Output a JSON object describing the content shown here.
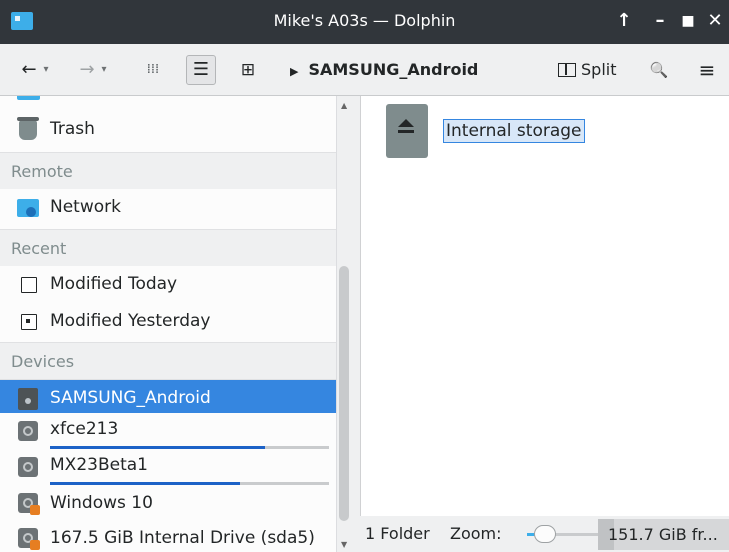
{
  "window": {
    "title": "Mike's A03s — Dolphin",
    "buttons": {
      "keep_above": "↑",
      "minimize": "–",
      "maximize": "■",
      "close": "✕"
    }
  },
  "toolbar": {
    "back": "←",
    "forward": "→",
    "dropdown": "▾",
    "icons_view": "⁞⁞⁞",
    "details_view": "☰",
    "compact_view": "⊞",
    "breadcrumb_arrow": "▶",
    "breadcrumb": "SAMSUNG_Android",
    "split_label": "Split",
    "search": "🔍",
    "menu": "≡"
  },
  "sidebar": {
    "places": [
      {
        "label": "Trash",
        "icon": "trash-icon"
      }
    ],
    "remote_header": "Remote",
    "remote": [
      {
        "label": "Network",
        "icon": "network-folder-icon"
      }
    ],
    "recent_header": "Recent",
    "recent": [
      {
        "label": "Modified Today",
        "icon": "calendar-icon"
      },
      {
        "label": "Modified Yesterday",
        "icon": "calendar-day-icon"
      }
    ],
    "devices_header": "Devices",
    "devices": [
      {
        "label": "SAMSUNG_Android",
        "icon": "phone-icon",
        "selected": true
      },
      {
        "label": "xfce213",
        "icon": "disk-icon",
        "usage": 0.77
      },
      {
        "label": "MX23Beta1",
        "icon": "disk-icon",
        "usage": 0.68
      },
      {
        "label": "Windows 10",
        "icon": "windows-disk-icon"
      },
      {
        "label": "167.5 GiB Internal Drive (sda5)",
        "icon": "windows-disk-icon"
      }
    ]
  },
  "main": {
    "items": [
      {
        "name": "Internal storage",
        "icon": "storage-icon",
        "selected": true
      }
    ]
  },
  "statusbar": {
    "summary": "1 Folder",
    "zoom_label": "Zoom:",
    "zoom_level": 0.1,
    "free_space": "151.7 GiB fr...",
    "free_space_used": 0.12
  },
  "colors": {
    "selection": "#3586e0",
    "accent": "#3daee9",
    "titlebar": "#31363b"
  }
}
